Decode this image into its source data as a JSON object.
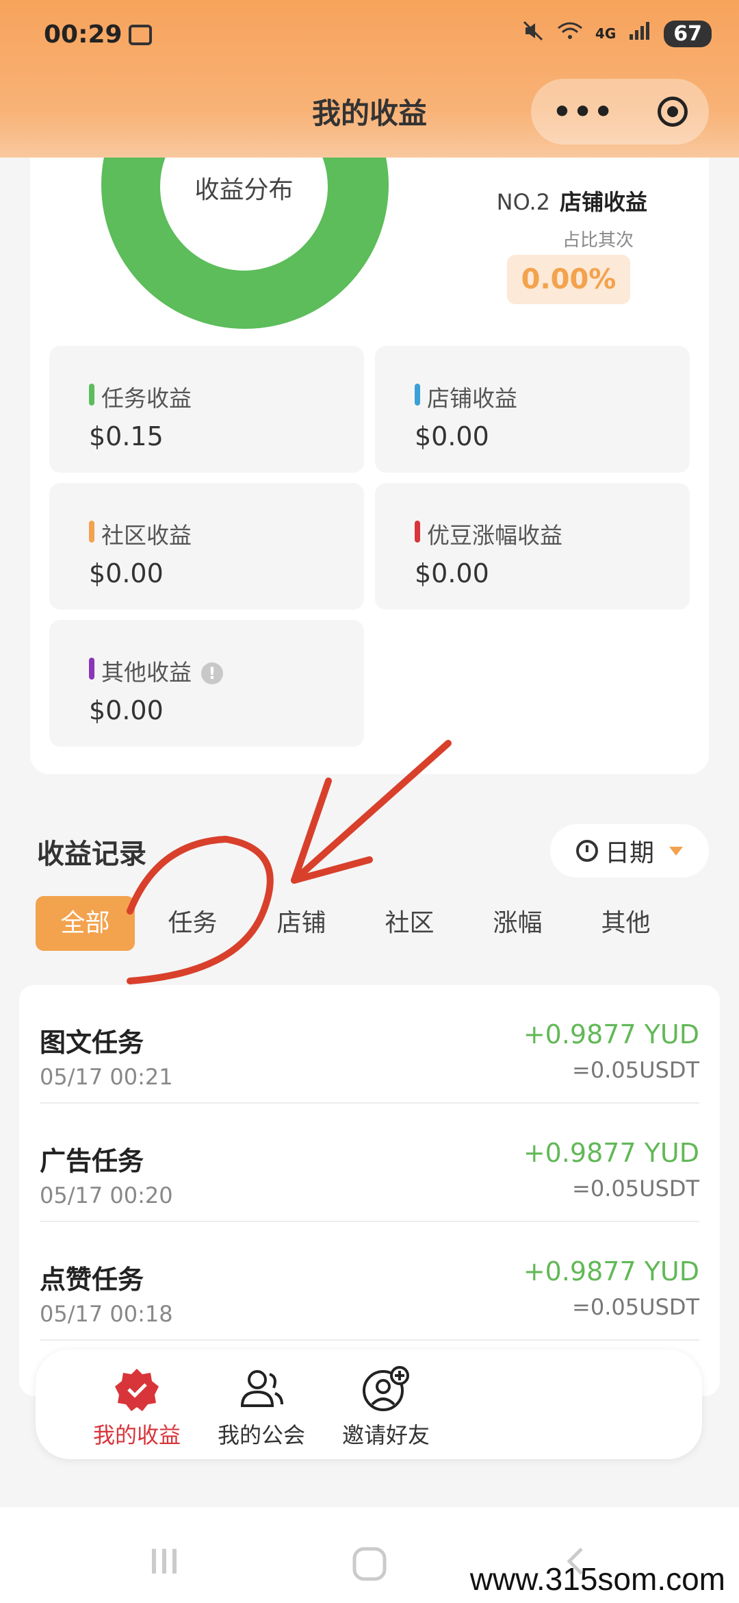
{
  "status_bar": {
    "time": "00:29",
    "network": "4G",
    "battery": "67"
  },
  "header": {
    "title": "我的收益",
    "more_label": "•••"
  },
  "summary": {
    "donut_label": "收益分布",
    "rank_no": "NO.2",
    "rank_name": "店铺收益",
    "rank_sub": "占比其次",
    "rank_percent": "0.00%",
    "categories": [
      {
        "label": "任务收益",
        "value": "$0.15",
        "color": "#5cbd5a"
      },
      {
        "label": "店铺收益",
        "value": "$0.00",
        "color": "#3aa0d8"
      },
      {
        "label": "社区收益",
        "value": "$0.00",
        "color": "#f3a24d"
      },
      {
        "label": "优豆涨幅收益",
        "value": "$0.00",
        "color": "#d8353a"
      },
      {
        "label": "其他收益",
        "value": "$0.00",
        "color": "#8c35b8"
      }
    ],
    "info_icon": "!"
  },
  "records": {
    "title": "收益记录",
    "date_filter": "日期",
    "tabs": [
      "全部",
      "任务",
      "店铺",
      "社区",
      "涨幅",
      "其他"
    ],
    "active_tab": 0,
    "items": [
      {
        "title": "图文任务",
        "time": "05/17 00:21",
        "amount": "+0.9877 YUD",
        "usdt": "=0.05USDT"
      },
      {
        "title": "广告任务",
        "time": "05/17 00:20",
        "amount": "+0.9877 YUD",
        "usdt": "=0.05USDT"
      },
      {
        "title": "点赞任务",
        "time": "05/17 00:18",
        "amount": "+0.9877 YUD",
        "usdt": "=0.05USDT"
      }
    ]
  },
  "bottom_nav": [
    {
      "label": "我的收益",
      "icon": "badge-check-icon"
    },
    {
      "label": "我的公会",
      "icon": "users-icon"
    },
    {
      "label": "邀请好友",
      "icon": "add-user-icon"
    }
  ],
  "watermark": "www.315som.com"
}
